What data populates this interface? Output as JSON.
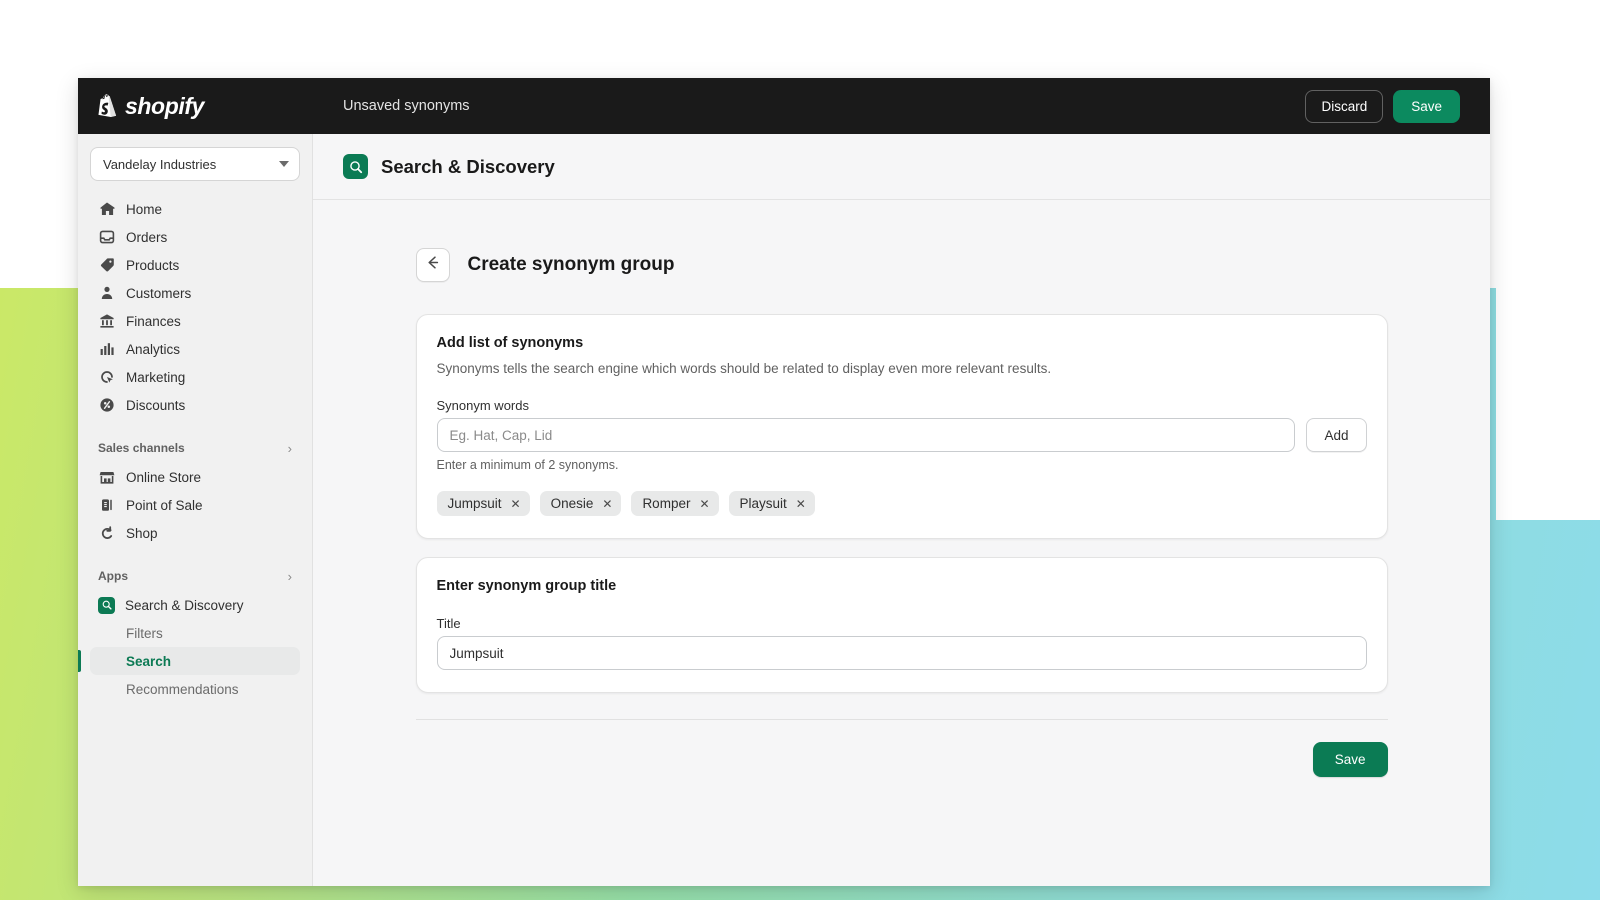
{
  "topbar": {
    "brand": "shopify",
    "brand_icon": "shopify-bag-icon",
    "title": "Unsaved synonyms",
    "discard_label": "Discard",
    "save_label": "Save"
  },
  "sidebar": {
    "store": "Vandelay Industries",
    "store_caret_icon": "caret-down-icon",
    "nav": [
      {
        "label": "Home",
        "icon": "home-icon"
      },
      {
        "label": "Orders",
        "icon": "orders-inbox-icon"
      },
      {
        "label": "Products",
        "icon": "product-tag-icon"
      },
      {
        "label": "Customers",
        "icon": "person-icon"
      },
      {
        "label": "Finances",
        "icon": "bank-icon"
      },
      {
        "label": "Analytics",
        "icon": "bar-chart-icon"
      },
      {
        "label": "Marketing",
        "icon": "megaphone-target-icon"
      },
      {
        "label": "Discounts",
        "icon": "discount-percent-icon"
      }
    ],
    "sales_channels": {
      "title": "Sales channels",
      "chevron_icon": "chevron-right-icon",
      "items": [
        {
          "label": "Online Store",
          "icon": "storefront-icon"
        },
        {
          "label": "Point of Sale",
          "icon": "pos-device-icon"
        },
        {
          "label": "Shop",
          "icon": "shop-bag-icon"
        }
      ]
    },
    "apps": {
      "title": "Apps",
      "chevron_icon": "chevron-right-icon",
      "app": {
        "label": "Search & Discovery",
        "icon": "search-discovery-app-icon"
      },
      "items": [
        {
          "label": "Filters",
          "active": false
        },
        {
          "label": "Search",
          "active": true
        },
        {
          "label": "Recommendations",
          "active": false
        }
      ]
    }
  },
  "page": {
    "app_icon": "search-discovery-app-icon",
    "app_title": "Search & Discovery",
    "back_icon": "arrow-left-icon",
    "heading": "Create synonym group"
  },
  "synonyms_card": {
    "title": "Add list of synonyms",
    "description": "Synonyms tells the search engine which words should be related to display even more relevant results.",
    "field_label": "Synonym words",
    "input_value": "",
    "input_placeholder": "Eg. Hat, Cap, Lid",
    "add_label": "Add",
    "help_text": "Enter a minimum of 2 synonyms.",
    "tags": [
      "Jumpsuit",
      "Onesie",
      "Romper",
      "Playsuit"
    ],
    "tag_remove_icon": "close-x-icon"
  },
  "title_card": {
    "title": "Enter synonym group title",
    "field_label": "Title",
    "input_value": "Jumpsuit"
  },
  "footer": {
    "save_label": "Save"
  },
  "colors": {
    "brand_green": "#0b7b54",
    "topbar_dark": "#1a1a1a",
    "page_bg": "#f6f6f7",
    "accent_green": "#0c7a54"
  }
}
